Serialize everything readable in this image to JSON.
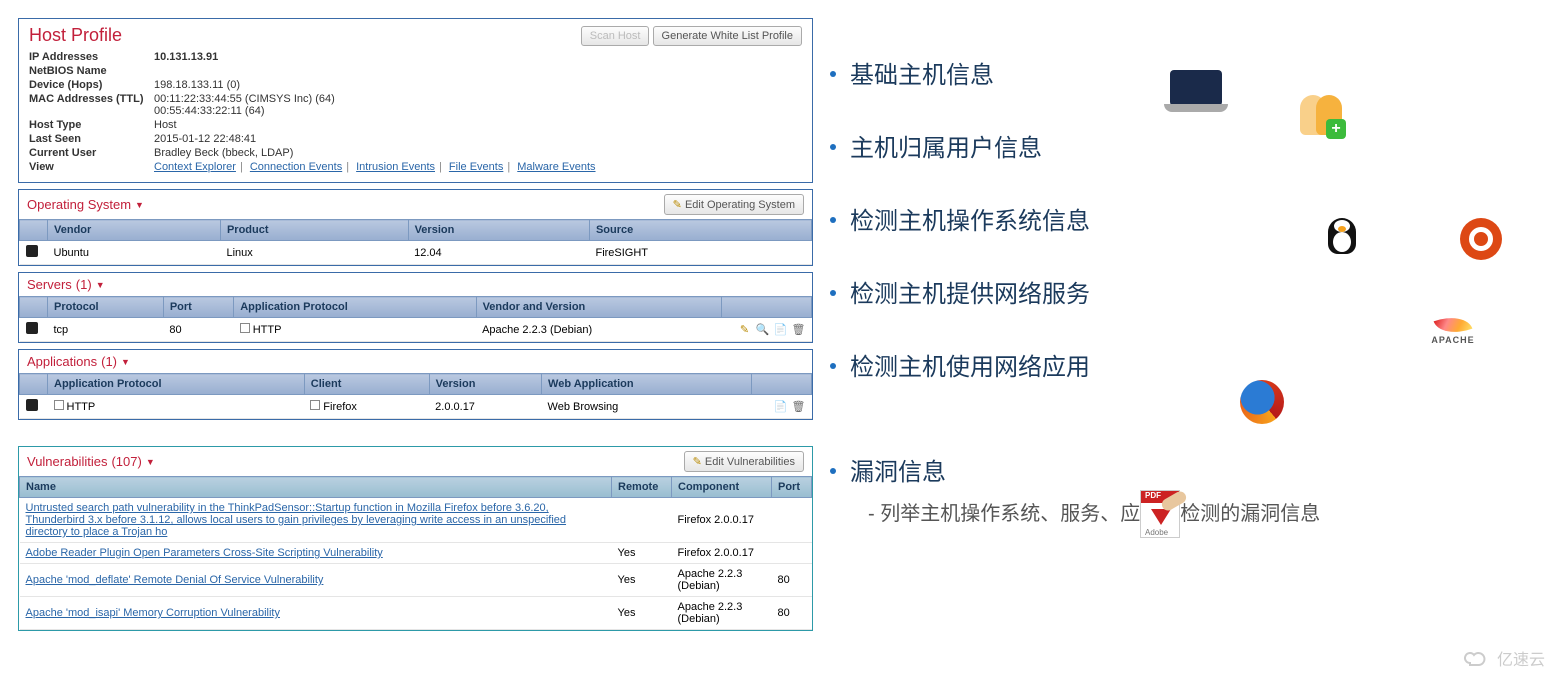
{
  "hostProfile": {
    "title": "Host Profile",
    "scanBtn": "Scan Host",
    "genBtn": "Generate White List Profile",
    "rows": {
      "ipLabel": "IP Addresses",
      "ip": "10.131.13.91",
      "nbLabel": "NetBIOS Name",
      "nb": "",
      "devLabel": "Device (Hops)",
      "dev": "198.18.133.11 (0)",
      "macLabel": "MAC Addresses (TTL)",
      "mac1": "00:11:22:33:44:55 (CIMSYS Inc) (64)",
      "mac2": "00:55:44:33:22:11 (64)",
      "htLabel": "Host Type",
      "ht": "Host",
      "lsLabel": "Last Seen",
      "ls": "2015-01-12 22:48:41",
      "cuLabel": "Current User",
      "cu": "Bradley Beck (bbeck, LDAP)",
      "viewLabel": "View",
      "links": {
        "ce": "Context Explorer",
        "conn": "Connection Events",
        "intr": "Intrusion Events",
        "file": "File Events",
        "mal": "Malware Events"
      }
    }
  },
  "os": {
    "title": "Operating System",
    "editBtn": "Edit Operating System",
    "cols": {
      "vendor": "Vendor",
      "product": "Product",
      "version": "Version",
      "source": "Source"
    },
    "row": {
      "vendor": "Ubuntu",
      "product": "Linux",
      "version": "12.04",
      "source": "FireSIGHT"
    }
  },
  "servers": {
    "title": "Servers",
    "count": "(1)",
    "cols": {
      "proto": "Protocol",
      "port": "Port",
      "appProto": "Application Protocol",
      "vv": "Vendor and Version"
    },
    "row": {
      "proto": "tcp",
      "port": "80",
      "appProto": "HTTP",
      "vv": "Apache 2.2.3 (Debian)"
    }
  },
  "apps": {
    "title": "Applications",
    "count": "(1)",
    "cols": {
      "appProto": "Application Protocol",
      "client": "Client",
      "version": "Version",
      "webApp": "Web Application"
    },
    "row": {
      "appProto": "HTTP",
      "client": "Firefox",
      "version": "2.0.0.17",
      "webApp": "Web Browsing"
    }
  },
  "vulns": {
    "title": "Vulnerabilities",
    "count": "(107)",
    "editBtn": "Edit Vulnerabilities",
    "cols": {
      "name": "Name",
      "remote": "Remote",
      "component": "Component",
      "port": "Port"
    },
    "rows": [
      {
        "name": "Untrusted search path vulnerability in the ThinkPadSensor::Startup function in Mozilla Firefox before 3.6.20, Thunderbird 3.x before 3.1.12, allows local users to gain privileges by leveraging write access in an unspecified directory to place a Trojan ho",
        "remote": "",
        "component": "Firefox 2.0.0.17",
        "port": ""
      },
      {
        "name": "Adobe Reader Plugin Open Parameters Cross-Site Scripting Vulnerability",
        "remote": "Yes",
        "component": "Firefox 2.0.0.17",
        "port": ""
      },
      {
        "name": "Apache 'mod_deflate' Remote Denial Of Service Vulnerability",
        "remote": "Yes",
        "component": "Apache 2.2.3 (Debian)",
        "port": "80"
      },
      {
        "name": "Apache 'mod_isapi' Memory Corruption Vulnerability",
        "remote": "Yes",
        "component": "Apache 2.2.3 (Debian)",
        "port": "80"
      }
    ]
  },
  "right": {
    "items": [
      "基础主机信息",
      "主机归属用户信息",
      "检测主机操作系统信息",
      "检测主机提供网络服务",
      "检测主机使用网络应用",
      "漏洞信息"
    ],
    "sub": "- 列举主机操作系统、服务、应用被检测的漏洞信息",
    "apache": "APACHE",
    "adobe": "Adobe"
  },
  "watermark": "亿速云"
}
